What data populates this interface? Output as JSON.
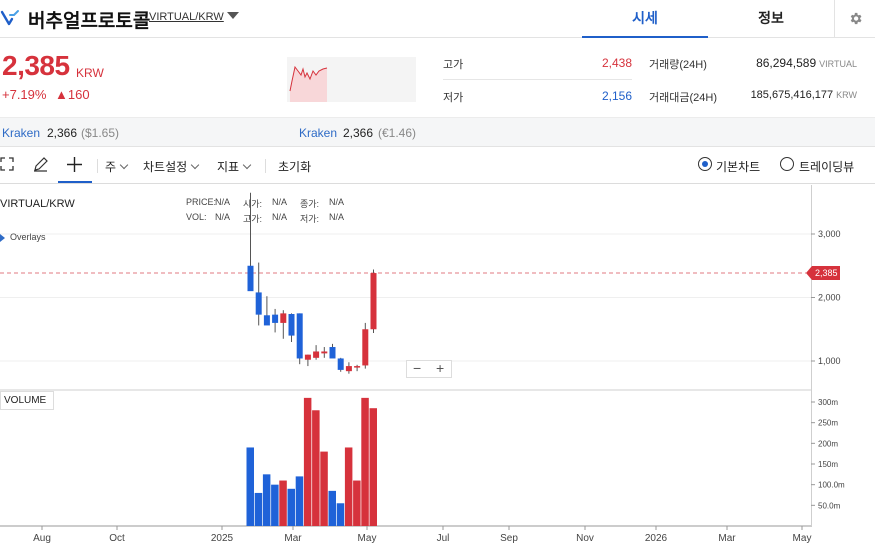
{
  "header": {
    "coin_name": "버추얼프로토콜",
    "pair": "VIRTUAL/KRW",
    "tabs": [
      {
        "label": "시세"
      },
      {
        "label": "정보"
      }
    ]
  },
  "price": {
    "current": "2,385",
    "unit": "KRW",
    "change_pct": "+7.19%",
    "change_amt": "▲160"
  },
  "stats": {
    "high_label": "고가",
    "high_value": "2,438",
    "low_label": "저가",
    "low_value": "2,156",
    "volume_label": "거래량(24H)",
    "volume_value": "86,294,589",
    "volume_unit": "VIRTUAL",
    "amount_label": "거래대금(24H)",
    "amount_value": "185,675,416,177",
    "amount_unit": "KRW"
  },
  "exchanges": [
    {
      "name": "Kraken",
      "price": "2,366",
      "sub": "($1.65)"
    },
    {
      "name": "Kraken",
      "price": "2,366",
      "sub": "(€1.46)"
    }
  ],
  "toolbar": {
    "period": "주",
    "chart_settings": "차트설정",
    "indicators": "지표",
    "reset": "초기화",
    "basic_chart": "기본차트",
    "tradingview": "트레이딩뷰"
  },
  "chart": {
    "title": "VIRTUAL/KRW",
    "overlays": "Overlays",
    "legend": {
      "price_label": "PRICE:",
      "price_val": "N/A",
      "open_label": "시가:",
      "open_val": "N/A",
      "close_label": "종가:",
      "close_val": "N/A",
      "vol_label": "VOL:",
      "vol_val": "N/A",
      "high_label": "고가:",
      "high_val": "N/A",
      "low_label": "저가:",
      "low_val": "N/A"
    },
    "volume_label": "VOLUME",
    "current_price_tag": "2,385",
    "zoom_out": "−",
    "zoom_in": "+"
  },
  "chart_data": {
    "type": "candlestick",
    "x_labels": [
      "Aug",
      "Oct",
      "2025",
      "Mar",
      "May",
      "Jul",
      "Sep",
      "Nov",
      "2026",
      "Mar",
      "May"
    ],
    "y_ticks": [
      {
        "v": 1000,
        "label": "1,000"
      },
      {
        "v": 2000,
        "label": "2,000"
      },
      {
        "v": 3000,
        "label": "3,000"
      }
    ],
    "vol_ticks": [
      {
        "v": 50,
        "label": "50.0m"
      },
      {
        "v": 100,
        "label": "100.0m"
      },
      {
        "v": 150,
        "label": "150m"
      },
      {
        "v": 200,
        "label": "200m"
      },
      {
        "v": 250,
        "label": "250m"
      },
      {
        "v": 300,
        "label": "300m"
      }
    ],
    "current_price": 2385,
    "up_color": "#d6323c",
    "down_color": "#1f62d8",
    "candles": [
      {
        "o": 2500,
        "h": 3650,
        "l": 2270,
        "c": 2100,
        "v": 190
      },
      {
        "o": 2080,
        "h": 2550,
        "l": 1560,
        "c": 1730,
        "v": 80
      },
      {
        "o": 1720,
        "h": 2020,
        "l": 1570,
        "c": 1560,
        "v": 125
      },
      {
        "o": 1730,
        "h": 1820,
        "l": 1450,
        "c": 1600,
        "v": 100
      },
      {
        "o": 1600,
        "h": 1800,
        "l": 1350,
        "c": 1750,
        "v": 110
      },
      {
        "o": 1740,
        "h": 1750,
        "l": 1300,
        "c": 1400,
        "v": 90
      },
      {
        "o": 1750,
        "h": 1750,
        "l": 950,
        "c": 1040,
        "v": 120
      },
      {
        "o": 1020,
        "h": 1100,
        "l": 920,
        "c": 1100,
        "v": 310
      },
      {
        "o": 1050,
        "h": 1250,
        "l": 1020,
        "c": 1150,
        "v": 280
      },
      {
        "o": 1120,
        "h": 1220,
        "l": 1050,
        "c": 1150,
        "v": 180
      },
      {
        "o": 1220,
        "h": 1270,
        "l": 1050,
        "c": 1040,
        "v": 85
      },
      {
        "o": 1040,
        "h": 1050,
        "l": 830,
        "c": 860,
        "v": 55
      },
      {
        "o": 840,
        "h": 980,
        "l": 800,
        "c": 920,
        "v": 190
      },
      {
        "o": 900,
        "h": 940,
        "l": 840,
        "c": 920,
        "v": 110
      },
      {
        "o": 930,
        "h": 1600,
        "l": 880,
        "c": 1500,
        "v": 310
      },
      {
        "o": 1500,
        "h": 2440,
        "l": 1440,
        "c": 2385,
        "v": 285
      }
    ]
  }
}
